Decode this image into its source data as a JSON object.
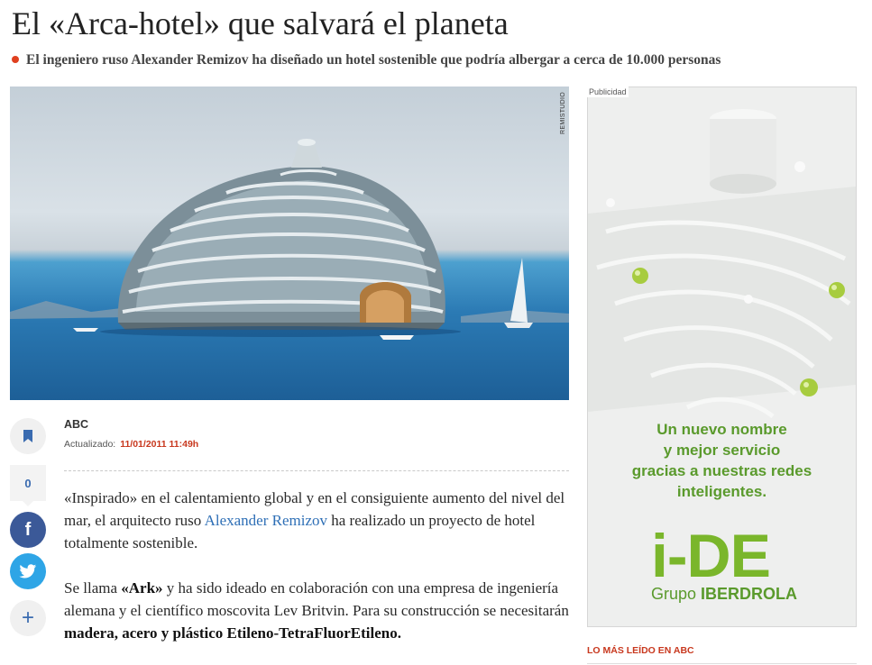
{
  "article": {
    "headline": "El «Arca-hotel» que salvará el planeta",
    "subtitle": "El ingeniero ruso Alexander Remizov ha diseñado un hotel sostenible que podría albergar a cerca de 10.000 personas",
    "image_credit": "REMISTUDIO",
    "author": "ABC",
    "updated_label": "Actualizado:",
    "updated_time": "11/01/2011 11:49h",
    "p1": {
      "a": "«Inspirado» en el calentamiento global y en el consiguiente aumento del nivel del mar, el arquitecto ruso ",
      "link": "Alexander Remizov",
      "b": " ha realizado un proyecto de hotel totalmente sostenible."
    },
    "p2": {
      "a": "Se llama ",
      "bold1": "«Ark»",
      "b": " y ha sido ideado en colaboración con una empresa de ingeniería alemana y el científico moscovita Lev Britvin. Para su construcción se necesitarán ",
      "bold2": "madera, acero y plástico Etileno-TetraFluorEtileno."
    }
  },
  "share": {
    "count": "0",
    "facebook_glyph": "f",
    "more_glyph": "+"
  },
  "ad": {
    "label": "Publicidad",
    "line1": "Un nuevo nombre",
    "line2": "y mejor servicio",
    "line3": "gracias a nuestras redes",
    "line4": "inteligentes.",
    "logo_text": "i-DE",
    "logo_sub_prefix": "Grupo ",
    "logo_sub_brand": "IBERDROLA",
    "brand_color": "#7ab62b"
  },
  "sidebar": {
    "most_read": "LO MÁS LEÍDO EN ABC"
  },
  "icons": [
    "bookmark-icon",
    "facebook-icon",
    "twitter-icon",
    "plus-icon",
    "leaf-icon"
  ],
  "colors": {
    "accent": "#c8381e",
    "link": "#2e6fb6",
    "facebook": "#3b5998",
    "twitter": "#2ea5e6"
  }
}
